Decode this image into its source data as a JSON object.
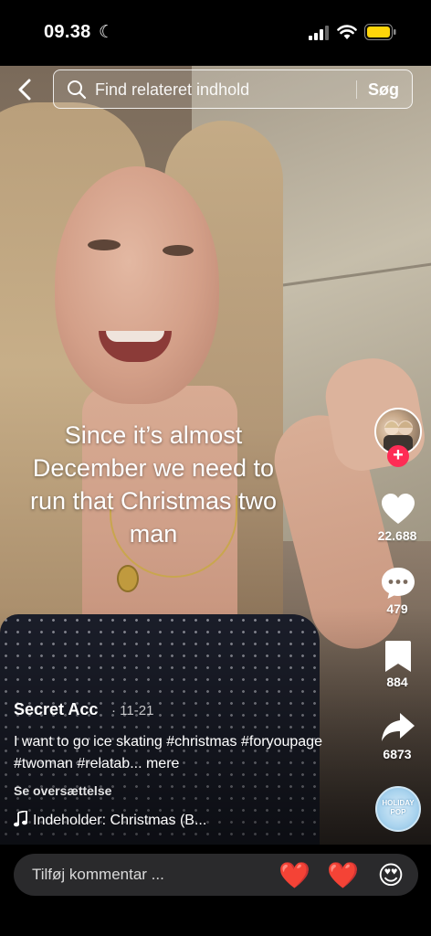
{
  "status_bar": {
    "time": "09.38",
    "focus_mode": "moon-icon",
    "signal": "signal-icon",
    "wifi": "wifi-icon",
    "battery": "battery-icon",
    "battery_color": "#ffd60a"
  },
  "search": {
    "placeholder": "Find relateret indhold",
    "submit_label": "Søg"
  },
  "video": {
    "overlay_text": "Since it’s almost December we need to run that Christmas two man"
  },
  "actions": {
    "likes": "22.688",
    "comments": "479",
    "saves": "884",
    "shares": "6873",
    "follow_symbol": "+",
    "accent_color": "#fe2c55"
  },
  "post": {
    "username": "Secret Acc",
    "date": "· 11-21",
    "caption": "I want to go ice skating #christmas #foryoupage #twoman #relatab... mere",
    "translate_label": "Se oversættelse",
    "sound": "Indeholder: Christmas (B...",
    "music_disc_label": "HOLIDAY POP"
  },
  "comment_bar": {
    "placeholder": "Tilføj kommentar ...",
    "quick_reactions": [
      "❤️",
      "❤️",
      "😍"
    ]
  }
}
